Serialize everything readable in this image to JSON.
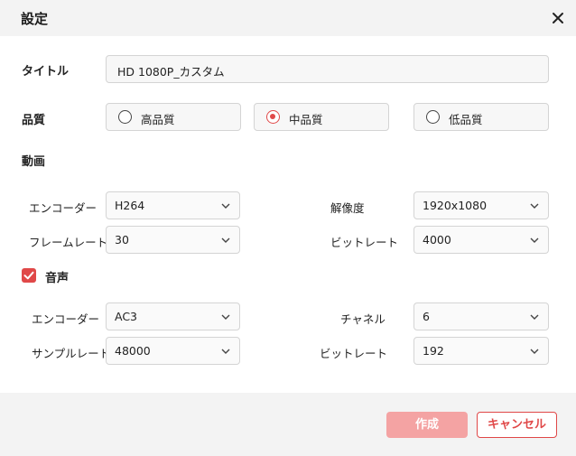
{
  "dialog": {
    "title": "設定",
    "close_icon": "close-icon"
  },
  "title_field": {
    "label": "タイトル",
    "value": "HD 1080P_カスタム"
  },
  "quality": {
    "label": "品質",
    "options": [
      "高品質",
      "中品質",
      "低品質"
    ],
    "selected": "中品質"
  },
  "video": {
    "label": "動画",
    "encoder_label": "エンコーダー",
    "encoder_value": "H264",
    "resolution_label": "解像度",
    "resolution_value": "1920x1080",
    "framerate_label": "フレームレート",
    "framerate_value": "30",
    "bitrate_label": "ビットレート",
    "bitrate_value": "4000"
  },
  "audio": {
    "label": "音声",
    "checked": true,
    "encoder_label": "エンコーダー",
    "encoder_value": "AC3",
    "channel_label": "チャネル",
    "channel_value": "6",
    "samplerate_label": "サンプルレート",
    "samplerate_value": "48000",
    "bitrate_label": "ビットレート",
    "bitrate_value": "192"
  },
  "footer": {
    "create_label": "作成",
    "cancel_label": "キャンセル"
  },
  "colors": {
    "accent": "#e04848",
    "accent_disabled": "#f4a3a3"
  }
}
